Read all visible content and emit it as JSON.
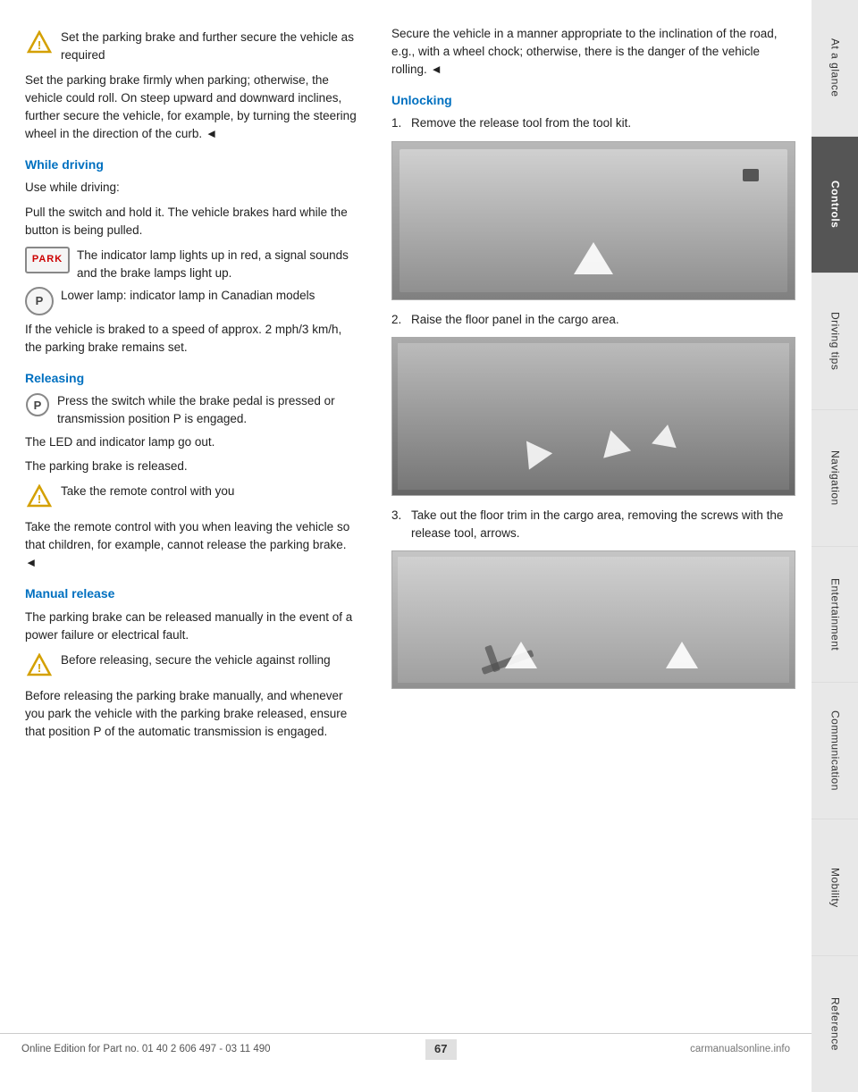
{
  "page": {
    "number": "67",
    "footer_text": "Online Edition for Part no. 01 40 2 606 497 - 03 11 490"
  },
  "sidebar": {
    "items": [
      {
        "label": "At a glance",
        "active": false
      },
      {
        "label": "Controls",
        "active": true
      },
      {
        "label": "Driving tips",
        "active": false
      },
      {
        "label": "Navigation",
        "active": false
      },
      {
        "label": "Entertainment",
        "active": false
      },
      {
        "label": "Communication",
        "active": false
      },
      {
        "label": "Mobility",
        "active": false
      },
      {
        "label": "Reference",
        "active": false
      }
    ]
  },
  "left_col": {
    "parking_brake_warning": "Set the parking brake and further secure the vehicle as required",
    "parking_brake_text": "Set the parking brake firmly when parking; otherwise, the vehicle could roll. On steep upward and downward inclines, further secure the vehicle, for example, by turning the steering wheel in the direction of the curb. ◄",
    "while_driving_heading": "While driving",
    "while_driving_use": "Use while driving:",
    "while_driving_pull": "Pull the switch and hold it. The vehicle brakes hard while the button is being pulled.",
    "park_indicator_text": "The indicator lamp lights up in red, a signal sounds and the brake lamps light up.",
    "park_lower_lamp": "Lower lamp: indicator lamp in Canadian models",
    "park_badge_label": "PARK",
    "circle_p_label": "P",
    "if_braked_text": "If the vehicle is braked to a speed of approx. 2 mph/3 km/h, the parking brake remains set.",
    "releasing_heading": "Releasing",
    "releasing_text": "Press the switch while the brake pedal is pressed or transmission position P is engaged.",
    "led_text": "The LED and indicator lamp go out.",
    "brake_released_text": "The parking brake is released.",
    "take_remote_warning": "Take the remote control with you",
    "take_remote_text": "Take the remote control with you when leaving the vehicle so that children, for example, cannot release the parking brake. ◄",
    "manual_release_heading": "Manual release",
    "manual_release_text1": "The parking brake can be released manually in the event of a power failure or electrical fault.",
    "before_releasing_warning": "Before releasing, secure the vehicle against rolling",
    "before_releasing_text": "Before releasing the parking brake manually, and whenever you park the vehicle with the parking brake released, ensure that position P of the automatic transmission is engaged."
  },
  "right_col": {
    "secure_vehicle_text": "Secure the vehicle in a manner appropriate to the inclination of the road, e.g., with a wheel chock; otherwise, there is the danger of the vehicle rolling. ◄",
    "unlocking_heading": "Unlocking",
    "step1_text": "Remove the release tool from the tool kit.",
    "step2_text": "Raise the floor panel in the cargo area.",
    "step3_text": "Take out the floor trim in the cargo area, removing the screws with the release tool, arrows."
  },
  "colors": {
    "accent_blue": "#0070C0",
    "sidebar_active": "#555555",
    "sidebar_inactive": "#e8e8e8",
    "warning_triangle": "#e8a000"
  }
}
